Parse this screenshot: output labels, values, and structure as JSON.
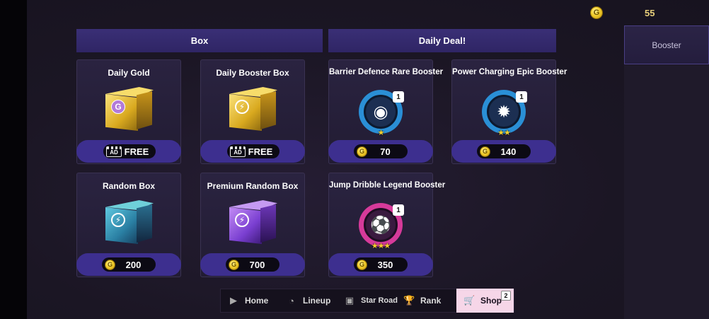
{
  "currency": {
    "icon": "gold-coin-icon",
    "symbol": "G",
    "amount": "55"
  },
  "side_tabs": [
    {
      "label": "Booster",
      "selected": true
    }
  ],
  "sections": {
    "box": {
      "title": "Box"
    },
    "daily_deal": {
      "title": "Daily Deal!"
    }
  },
  "box_items": [
    {
      "title": "Daily Gold",
      "price_type": "ad",
      "ad_label": "AD",
      "price": "FREE",
      "art": "gold-box-icon",
      "emblem": "G"
    },
    {
      "title": "Daily Booster Box",
      "price_type": "ad",
      "ad_label": "AD",
      "price": "FREE",
      "art": "gold-booster-box-icon",
      "emblem": "⚡"
    },
    {
      "title": "Random Box",
      "price_type": "gold",
      "coin": "G",
      "price": "200",
      "art": "teal-box-icon",
      "emblem": "⚡"
    },
    {
      "title": "Premium Random Box",
      "price_type": "gold",
      "coin": "G",
      "price": "700",
      "art": "purple-box-icon",
      "emblem": "⚡"
    }
  ],
  "deal_items": [
    {
      "title": "Barrier Defence Rare Booster",
      "count": "1",
      "stars": "★",
      "coin": "G",
      "price": "70",
      "icon": "barrier-defence-icon",
      "ring_color": "#2a8fd6"
    },
    {
      "title": "Power Charging Epic Booster",
      "count": "1",
      "stars": "★★",
      "coin": "G",
      "price": "140",
      "icon": "power-charging-icon",
      "ring_color": "#2a8fd6"
    },
    {
      "title": "Jump Dribble Legend Booster",
      "count": "1",
      "stars": "★★★",
      "coin": "G",
      "price": "350",
      "icon": "jump-dribble-icon",
      "ring_color": "#d63a9a"
    }
  ],
  "nav": [
    {
      "label": "Home",
      "icon": "home-icon"
    },
    {
      "label": "Lineup",
      "icon": "lineup-icon"
    },
    {
      "label": "Star Road",
      "icon": "star-road-icon"
    },
    {
      "label": "Rank",
      "icon": "trophy-icon"
    },
    {
      "label": "Shop",
      "icon": "cart-icon",
      "badge": "2",
      "active": true
    }
  ]
}
